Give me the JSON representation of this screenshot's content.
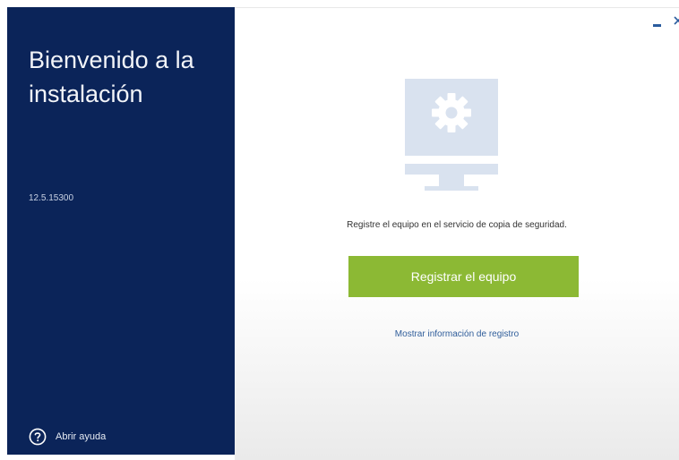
{
  "sidebar": {
    "title": "Bienvenido a la instalación",
    "version": "12.5.15300",
    "help_label": "Abrir ayuda",
    "background_color": "#0b2459"
  },
  "window_controls": {
    "minimize": "minimize-icon",
    "close": "close-icon"
  },
  "main": {
    "illustration": "monitor-gear-icon",
    "message": "Registre el equipo en el servicio de copia de seguridad.",
    "register_button_label": "Registrar el equipo",
    "register_button_color": "#8cb934",
    "registration_info_link": "Mostrar información de registro"
  }
}
